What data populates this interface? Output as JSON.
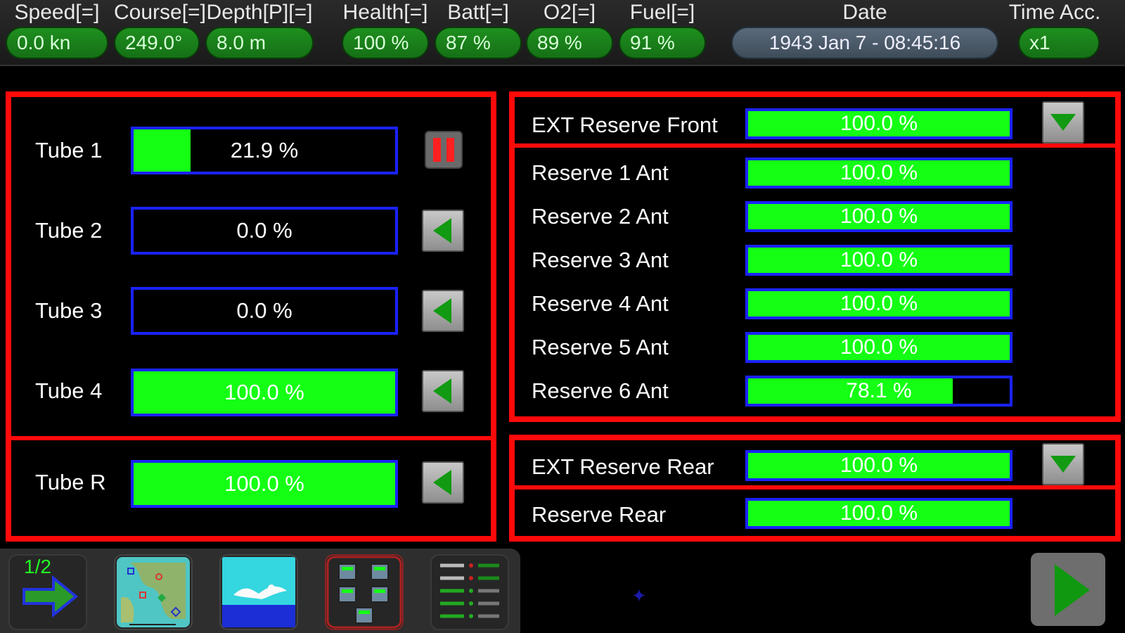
{
  "status_bar": {
    "speed": {
      "label": "Speed[=]",
      "value": "0.0 kn"
    },
    "course": {
      "label": "Course[=]",
      "value": "249.0°"
    },
    "depth": {
      "label": "Depth[P][=]",
      "value": "8.0 m"
    },
    "health": {
      "label": "Health[=]",
      "value": "100 %"
    },
    "batt": {
      "label": "Batt[=]",
      "value": "87 %"
    },
    "o2": {
      "label": "O2[=]",
      "value": "89 %"
    },
    "fuel": {
      "label": "Fuel[=]",
      "value": "91 %"
    },
    "date": {
      "label": "Date",
      "value": "1943 Jan 7 - 08:45:16"
    },
    "time_acc": {
      "label": "Time Acc.",
      "value": "x1"
    }
  },
  "tubes": [
    {
      "label": "Tube 1",
      "text": "21.9 %",
      "fill": 0.219,
      "action": "pause"
    },
    {
      "label": "Tube 2",
      "text": "0.0 %",
      "fill": 0.0,
      "action": "load"
    },
    {
      "label": "Tube 3",
      "text": "0.0 %",
      "fill": 0.0,
      "action": "load"
    },
    {
      "label": "Tube 4",
      "text": "100.0 %",
      "fill": 1.0,
      "action": "load"
    },
    {
      "label": "Tube R",
      "text": "100.0 %",
      "fill": 1.0,
      "action": "load"
    }
  ],
  "front_reserve": {
    "ext": {
      "label": "EXT Reserve Front",
      "text": "100.0 %",
      "fill": 1.0
    },
    "rows": [
      {
        "label": "Reserve 1 Ant",
        "text": "100.0 %",
        "fill": 1.0
      },
      {
        "label": "Reserve 2 Ant",
        "text": "100.0 %",
        "fill": 1.0
      },
      {
        "label": "Reserve 3 Ant",
        "text": "100.0 %",
        "fill": 1.0
      },
      {
        "label": "Reserve 4 Ant",
        "text": "100.0 %",
        "fill": 1.0
      },
      {
        "label": "Reserve 5 Ant",
        "text": "100.0 %",
        "fill": 1.0
      },
      {
        "label": "Reserve 6 Ant",
        "text": "78.1 %",
        "fill": 0.781
      }
    ]
  },
  "rear_reserve": {
    "ext": {
      "label": "EXT Reserve Rear",
      "text": "100.0 %",
      "fill": 1.0
    },
    "rows": [
      {
        "label": "Reserve Rear",
        "text": "100.0 %",
        "fill": 1.0
      }
    ]
  },
  "toolbar": {
    "page_indicator": "1/2",
    "tools": [
      "next-page-arrow-icon",
      "map-icon",
      "periscope-view-icon",
      "torpedo-room-icon",
      "gauges-panel-icon"
    ]
  },
  "colors": {
    "panel_border": "#ff0a0a",
    "bar_border": "#1a22ff",
    "bar_fill": "#14ff14",
    "status_green": "#1f8f1f"
  }
}
